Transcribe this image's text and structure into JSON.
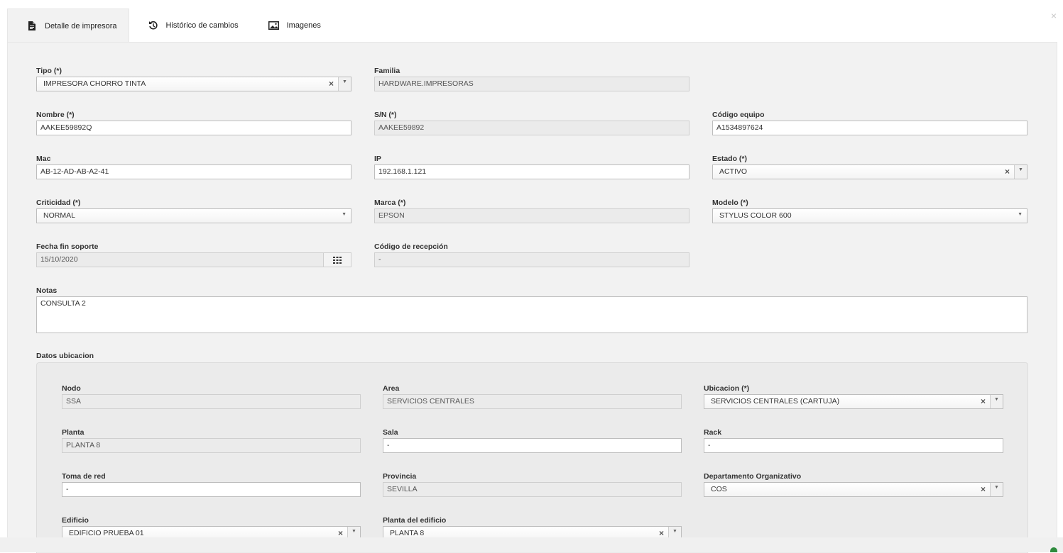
{
  "tabs": [
    {
      "label": "Detalle de impresora",
      "icon": "document-icon",
      "active": true
    },
    {
      "label": "Histórico de cambios",
      "icon": "history-icon",
      "active": false
    },
    {
      "label": "Imagenes",
      "icon": "image-icon",
      "active": false
    }
  ],
  "close_label": "×",
  "form": {
    "tipo": {
      "label": "Tipo (*)",
      "value": "IMPRESORA CHORRO TINTA"
    },
    "familia": {
      "label": "Familia",
      "value": "HARDWARE.IMPRESORAS"
    },
    "nombre": {
      "label": "Nombre (*)",
      "value": "AAKEE59892Q"
    },
    "sn": {
      "label": "S/N (*)",
      "value": "AAKEE59892"
    },
    "codigo_equipo": {
      "label": "Código equipo",
      "value": "A1534897624"
    },
    "mac": {
      "label": "Mac",
      "value": "AB-12-AD-AB-A2-41"
    },
    "ip": {
      "label": "IP",
      "value": "192.168.1.121"
    },
    "estado": {
      "label": "Estado (*)",
      "value": "ACTIVO"
    },
    "criticidad": {
      "label": "Criticidad (*)",
      "value": "NORMAL"
    },
    "marca": {
      "label": "Marca (*)",
      "value": "EPSON"
    },
    "modelo": {
      "label": "Modelo (*)",
      "value": "STYLUS COLOR 600"
    },
    "fecha_fin_soporte": {
      "label": "Fecha fin soporte",
      "value": "15/10/2020"
    },
    "codigo_recepcion": {
      "label": "Código de recepción",
      "value": "-"
    },
    "notas": {
      "label": "Notas",
      "value": "CONSULTA 2"
    }
  },
  "ubicacion": {
    "title": "Datos ubicacion",
    "nodo": {
      "label": "Nodo",
      "value": "SSA"
    },
    "area": {
      "label": "Area",
      "value": "SERVICIOS CENTRALES"
    },
    "ubicacion": {
      "label": "Ubicacion (*)",
      "value": "SERVICIOS CENTRALES (CARTUJA)"
    },
    "planta": {
      "label": "Planta",
      "value": "PLANTA 8"
    },
    "sala": {
      "label": "Sala",
      "value": "-"
    },
    "rack": {
      "label": "Rack",
      "value": "-"
    },
    "toma_red": {
      "label": "Toma de red",
      "value": "-"
    },
    "provincia": {
      "label": "Provincia",
      "value": "SEVILLA"
    },
    "departamento": {
      "label": "Departamento Organizativo",
      "value": "COS"
    },
    "edificio": {
      "label": "Edificio",
      "value": "EDIFICIO PRUEBA 01"
    },
    "planta_edificio": {
      "label": "Planta del edificio",
      "value": "PLANTA 8"
    }
  },
  "icons": {
    "clear": "×",
    "dropdown": "▼"
  }
}
